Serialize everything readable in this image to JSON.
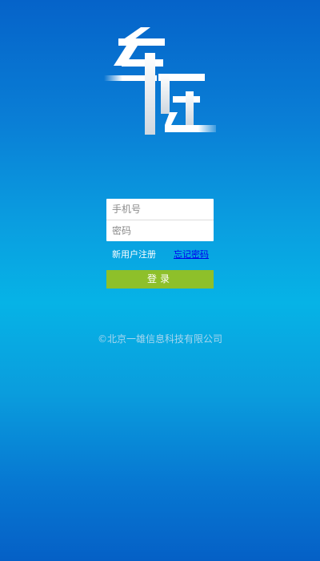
{
  "app": {
    "logo_text": "车厅"
  },
  "login_form": {
    "phone_placeholder": "手机号",
    "password_placeholder": "密码",
    "register_label": "新用户注册",
    "forgot_password_label": "忘记密码",
    "login_button_label": "登录"
  },
  "footer": {
    "copyright": "©北京一雄信息科技有限公司"
  },
  "colors": {
    "login_button": "#8ec02a",
    "forgot_link": "#0000ee",
    "background_top": "#0563c9",
    "background_middle": "#06b3e6"
  }
}
